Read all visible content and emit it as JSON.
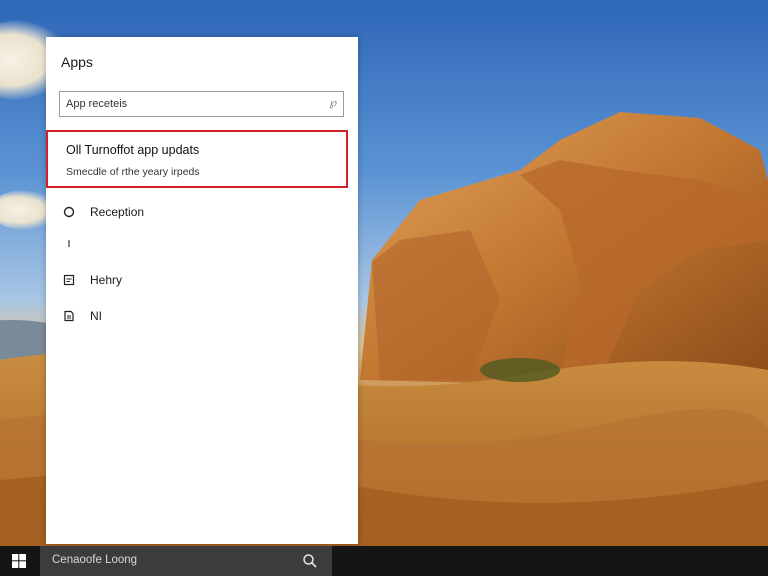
{
  "panel": {
    "title": "Apps",
    "search": {
      "value": "App receteis",
      "icon": "search-icon"
    },
    "highlighted_item": {
      "title": "Oll  Turnoffot app updats",
      "subtitle": "Smecdle of rthe yeary irpeds",
      "border_color": "#d0202a"
    },
    "items": [
      {
        "icon": "circle-icon",
        "label": "Reception"
      },
      {
        "icon": "small-mark-icon",
        "label": ""
      },
      {
        "icon": "document-icon",
        "label": "Hehry"
      },
      {
        "icon": "page-icon",
        "label": "NI"
      }
    ]
  },
  "taskbar": {
    "start_icon": "windows-logo-icon",
    "search_text": "Cenaoofe Loong",
    "search_icon": "search-icon"
  }
}
